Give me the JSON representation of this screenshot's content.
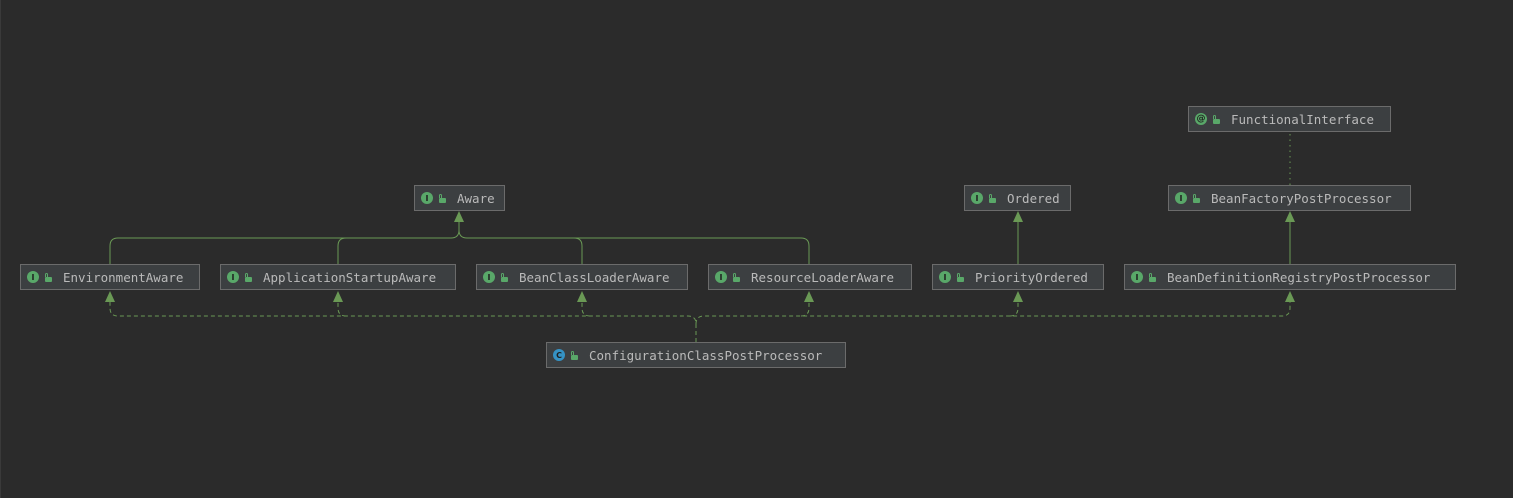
{
  "diagram": {
    "nodes": [
      {
        "id": "functional-interface",
        "label": "FunctionalInterface",
        "kind": "annotation",
        "kind_glyph": "@"
      },
      {
        "id": "aware",
        "label": "Aware",
        "kind": "interface",
        "kind_glyph": "I"
      },
      {
        "id": "ordered",
        "label": "Ordered",
        "kind": "interface",
        "kind_glyph": "I"
      },
      {
        "id": "bean-factory-post-processor",
        "label": "BeanFactoryPostProcessor",
        "kind": "interface",
        "kind_glyph": "I"
      },
      {
        "id": "environment-aware",
        "label": "EnvironmentAware",
        "kind": "interface",
        "kind_glyph": "I"
      },
      {
        "id": "application-startup-aware",
        "label": "ApplicationStartupAware",
        "kind": "interface",
        "kind_glyph": "I"
      },
      {
        "id": "bean-class-loader-aware",
        "label": "BeanClassLoaderAware",
        "kind": "interface",
        "kind_glyph": "I"
      },
      {
        "id": "resource-loader-aware",
        "label": "ResourceLoaderAware",
        "kind": "interface",
        "kind_glyph": "I"
      },
      {
        "id": "priority-ordered",
        "label": "PriorityOrdered",
        "kind": "interface",
        "kind_glyph": "I"
      },
      {
        "id": "bean-definition-registry-post-processor",
        "label": "BeanDefinitionRegistryPostProcessor",
        "kind": "interface",
        "kind_glyph": "I"
      },
      {
        "id": "configuration-class-post-processor",
        "label": "ConfigurationClassPostProcessor",
        "kind": "class",
        "kind_glyph": "C"
      }
    ],
    "edges": [
      {
        "from": "environment-aware",
        "to": "aware",
        "type": "extends"
      },
      {
        "from": "application-startup-aware",
        "to": "aware",
        "type": "extends"
      },
      {
        "from": "bean-class-loader-aware",
        "to": "aware",
        "type": "extends"
      },
      {
        "from": "resource-loader-aware",
        "to": "aware",
        "type": "extends"
      },
      {
        "from": "priority-ordered",
        "to": "ordered",
        "type": "extends"
      },
      {
        "from": "bean-definition-registry-post-processor",
        "to": "bean-factory-post-processor",
        "type": "extends"
      },
      {
        "from": "bean-factory-post-processor",
        "to": "functional-interface",
        "type": "annotated"
      },
      {
        "from": "configuration-class-post-processor",
        "to": "environment-aware",
        "type": "implements"
      },
      {
        "from": "configuration-class-post-processor",
        "to": "application-startup-aware",
        "type": "implements"
      },
      {
        "from": "configuration-class-post-processor",
        "to": "bean-class-loader-aware",
        "type": "implements"
      },
      {
        "from": "configuration-class-post-processor",
        "to": "resource-loader-aware",
        "type": "implements"
      },
      {
        "from": "configuration-class-post-processor",
        "to": "priority-ordered",
        "type": "implements"
      },
      {
        "from": "configuration-class-post-processor",
        "to": "bean-definition-registry-post-processor",
        "type": "implements"
      }
    ]
  },
  "colors": {
    "background": "#2b2b2b",
    "node_fill": "#3c3f41",
    "node_border": "#6b6b6b",
    "node_text": "#bababa",
    "edge": "#6a9955",
    "interface_badge": "#59a869",
    "class_badge": "#3592c4"
  }
}
